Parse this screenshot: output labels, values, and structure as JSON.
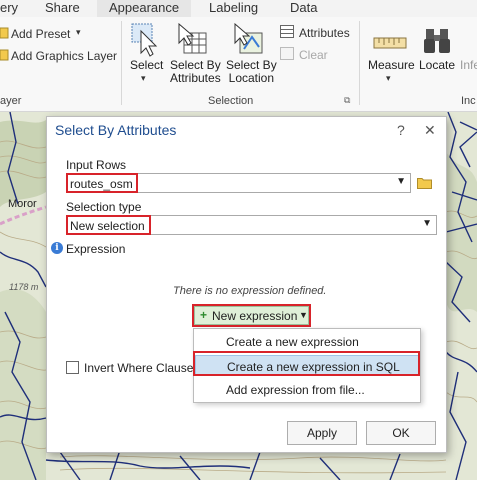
{
  "ribbon": {
    "tabs": [
      "ery",
      "Share",
      "Appearance",
      "Labeling",
      "Data"
    ],
    "add_preset": "Add Preset",
    "add_graphics_layer": "Add Graphics Layer",
    "layer_group_label": "ayer",
    "select_label": "Select",
    "select_by_attributes_label1": "Select By",
    "select_by_attributes_label2": "Attributes",
    "select_by_location_label1": "Select By",
    "select_by_location_label2": "Location",
    "attributes_label": "Attributes",
    "clear_label": "Clear",
    "selection_group_label": "Selection",
    "measure_label": "Measure",
    "locate_label": "Locate",
    "infer_label": "Infe",
    "inquiry_group_label": "Inc"
  },
  "map": {
    "place_label": "Moror",
    "elevation_label": "1178 m"
  },
  "dialog": {
    "title": "Select By Attributes",
    "help": "?",
    "close": "✕",
    "input_rows_label": "Input Rows",
    "input_rows_value": "routes_osm",
    "selection_type_label": "Selection type",
    "selection_type_value": "New selection",
    "expression_label": "Expression",
    "no_expression_text": "There is no expression defined.",
    "new_expression_label": "New expression",
    "invert_label": "Invert Where Clause",
    "apply_label": "Apply",
    "ok_label": "OK"
  },
  "menu": {
    "items": [
      "Create a new expression",
      "Create a new expression in SQL",
      "Add expression from file..."
    ],
    "selected_index": 1
  },
  "colors": {
    "highlight": "#d8232a",
    "title": "#1f4d8f",
    "map_road": "#1f2f7a",
    "map_contour": "#b9ab88"
  }
}
